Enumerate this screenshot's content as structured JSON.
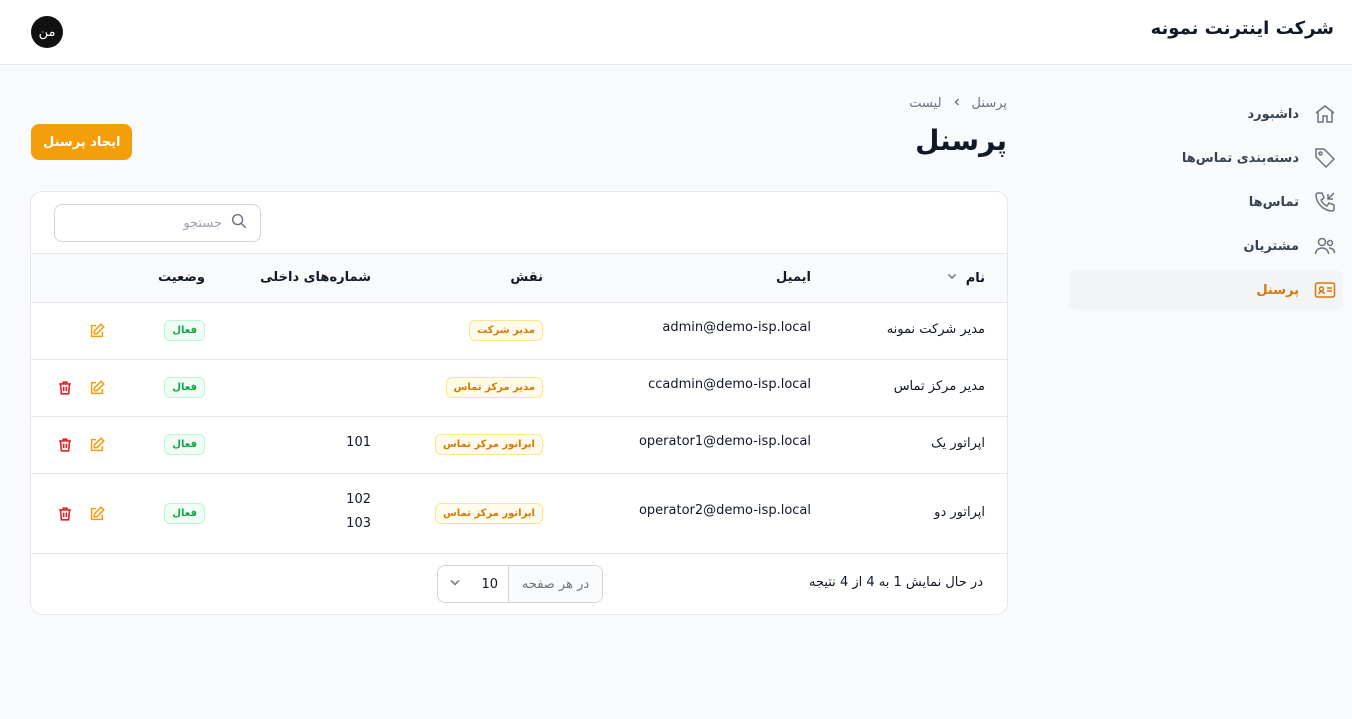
{
  "header": {
    "brand": "شرکت اینترنت نمونه",
    "avatar_initials": "من"
  },
  "sidebar": {
    "items": [
      {
        "label": "داشبورد",
        "icon": "home-icon",
        "active": false
      },
      {
        "label": "دسته‌بندی تماس‌ها",
        "icon": "tag-icon",
        "active": false
      },
      {
        "label": "تماس‌ها",
        "icon": "phone-incoming-icon",
        "active": false
      },
      {
        "label": "مشتریان",
        "icon": "users-icon",
        "active": false
      },
      {
        "label": "پرسنل",
        "icon": "id-card-icon",
        "active": true
      }
    ]
  },
  "breadcrumb": {
    "root": "پرسنل",
    "current": "لیست"
  },
  "page": {
    "title": "پرسنل",
    "create_label": "ایجاد پرسنل"
  },
  "search": {
    "placeholder": "جستجو"
  },
  "table": {
    "columns": {
      "name": "نام",
      "email": "ایمیل",
      "role": "نقش",
      "extensions": "شماره‌های داخلی",
      "status": "وضعیت"
    },
    "rows": [
      {
        "name": "مدیر شرکت نمونه",
        "email": "admin@demo-isp.local",
        "role": "مدیر شرکت",
        "ext1": "",
        "ext2": "",
        "status": "فعال"
      },
      {
        "name": "مدیر مرکز تماس",
        "email": "ccadmin@demo-isp.local",
        "role": "مدیر مرکز تماس",
        "ext1": "",
        "ext2": "",
        "status": "فعال"
      },
      {
        "name": "اپراتور یک",
        "email": "operator1@demo-isp.local",
        "role": "اپراتور مرکز تماس",
        "ext1": "101",
        "ext2": "",
        "status": "فعال"
      },
      {
        "name": "اپراتور دو",
        "email": "operator2@demo-isp.local",
        "role": "اپراتور مرکز تماس",
        "ext1": "102",
        "ext2": "103",
        "status": "فعال"
      }
    ]
  },
  "footer": {
    "summary": "در حال نمایش 1 به 4 از 4 نتیجه",
    "per_page_label": "در هر صفحه",
    "per_page_value": "10"
  },
  "colors": {
    "accent": "#f59e0b",
    "accent_text": "#d97706",
    "success": "#16a34a",
    "danger": "#dc2626"
  }
}
